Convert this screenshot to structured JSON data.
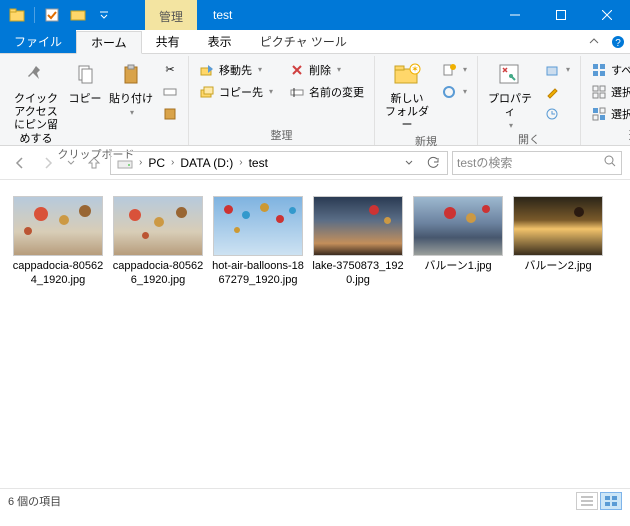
{
  "window": {
    "context_tab": "管理",
    "title": "test"
  },
  "tabs": {
    "file": "ファイル",
    "home": "ホーム",
    "share": "共有",
    "view": "表示",
    "picture_tools": "ピクチャ ツール"
  },
  "ribbon": {
    "clipboard": {
      "pin_quick": "クイック アクセスにピン留めする",
      "copy": "コピー",
      "paste": "貼り付け",
      "label": "クリップボード"
    },
    "organize": {
      "move_to": "移動先",
      "copy_to": "コピー先",
      "delete": "削除",
      "rename": "名前の変更",
      "label": "整理"
    },
    "new": {
      "new_folder": "新しい\nフォルダー",
      "label": "新規"
    },
    "open": {
      "properties": "プロパティ",
      "label": "開く"
    },
    "select": {
      "select_all": "すべて選択",
      "select_none": "選択解除",
      "invert": "選択の切り替え",
      "label": "選択"
    }
  },
  "breadcrumbs": [
    "PC",
    "DATA (D:)",
    "test"
  ],
  "search": {
    "placeholder": "testの検索"
  },
  "files": [
    {
      "name": "cappadocia-805624_1920.jpg",
      "thumb": "sky-day"
    },
    {
      "name": "cappadocia-805626_1920.jpg",
      "thumb": "sky-day"
    },
    {
      "name": "hot-air-balloons-1867279_1920.jpg",
      "thumb": "sky-blue"
    },
    {
      "name": "lake-3750873_1920.jpg",
      "thumb": "sky-dusk"
    },
    {
      "name": "バルーン1.jpg",
      "thumb": "sky-lake"
    },
    {
      "name": "バルーン2.jpg",
      "thumb": "sky-sun"
    }
  ],
  "status": {
    "count": "6 個の項目"
  }
}
